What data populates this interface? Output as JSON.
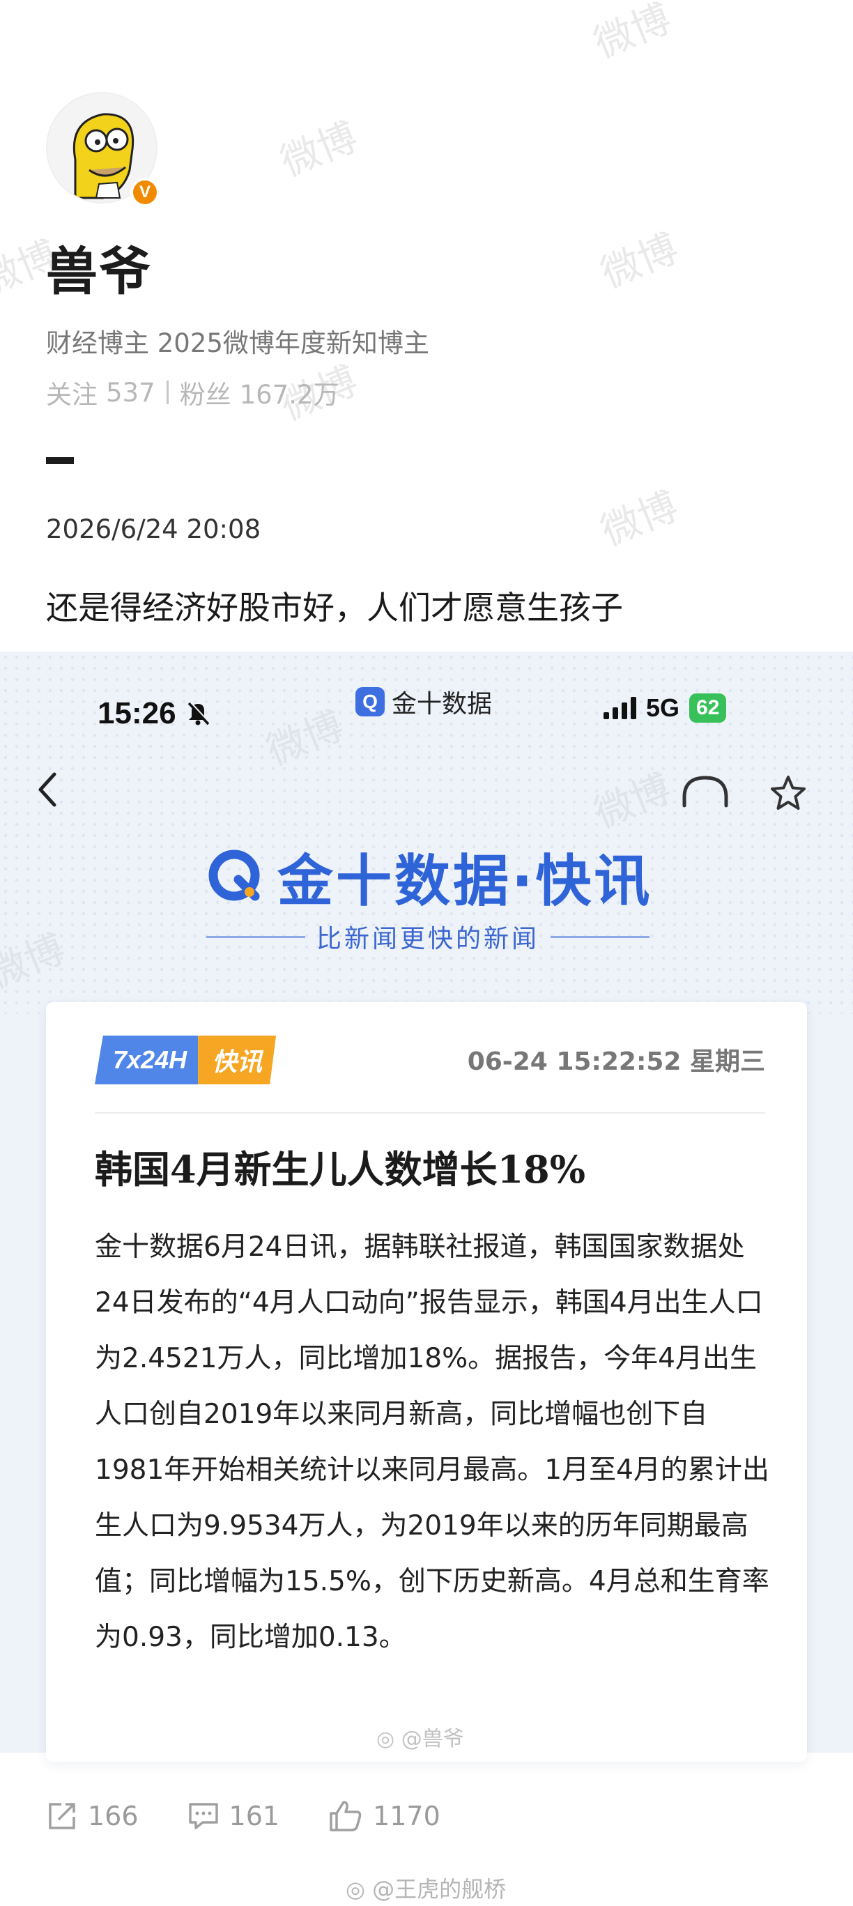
{
  "watermark": "微博",
  "profile": {
    "name": "兽爷",
    "verified_badge": "V",
    "bio": "财经博主 2025微博年度新知博主",
    "following_label": "关注",
    "following_count": "537",
    "followers_label": "粉丝",
    "followers_count": "167.2万"
  },
  "post": {
    "date": "2026/6/24 20:08",
    "text": "还是得经济好股市好，人们才愿意生孩子"
  },
  "embedded": {
    "status_bar": {
      "time": "15:26",
      "app_name": "金十数据",
      "app_logo_letter": "Q",
      "network": "5G",
      "battery": "62"
    },
    "brand_title": "金十数据·快讯",
    "tagline": "比新闻更快的新闻",
    "card": {
      "tag_a": "7x24H",
      "tag_b": "快讯",
      "timestamp": "06-24 15:22:52 星期三",
      "headline": "韩国4月新生儿人数增长18%",
      "body": "金十数据6月24日讯，据韩联社报道，韩国国家数据处24日发布的“4月人口动向”报告显示，韩国4月出生人口为2.4521万人，同比增加18%。据报告，今年4月出生人口创自2019年以来同月新高，同比增幅也创下自1981年开始相关统计以来同月最高。1月至4月的累计出生人口为9.9534万人，为2019年以来的历年同期最高值；同比增幅为15.5%，创下历史新高。4月总和生育率为0.93，同比增加0.13。"
    },
    "weibo_mark": "@兽爷"
  },
  "actions": {
    "share_count": "166",
    "comment_count": "161",
    "like_count": "1170"
  },
  "footer_mark": "@王虎的舰桥",
  "icons": [
    "share-icon",
    "comment-icon",
    "like-icon",
    "mute-icon",
    "back-icon",
    "headphone-icon",
    "star-icon",
    "weibo-logo-icon"
  ]
}
